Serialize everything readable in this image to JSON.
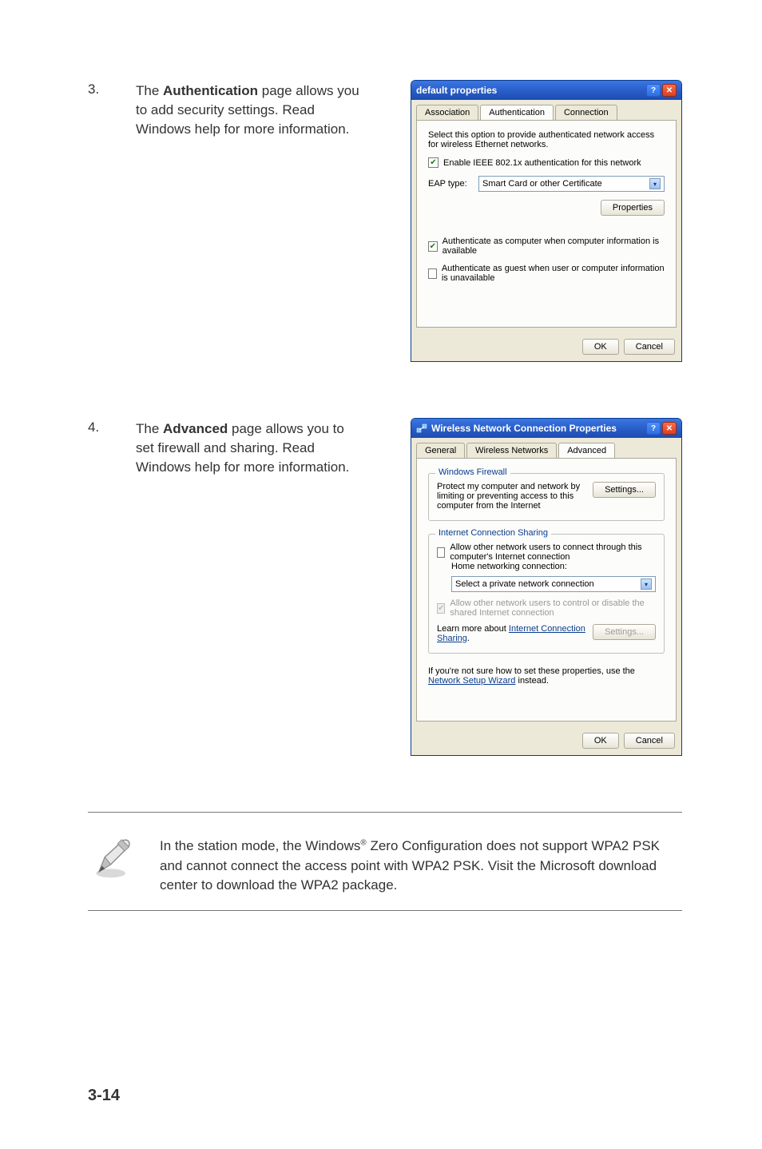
{
  "step3": {
    "num": "3.",
    "text_pre": "The ",
    "text_bold": "Authentication",
    "text_post": " page allows you to add security settings. Read Windows help for more information."
  },
  "dlg1": {
    "title": "default properties",
    "tabs": {
      "assoc": "Association",
      "auth": "Authentication",
      "conn": "Connection"
    },
    "desc": "Select this option to provide authenticated network access for wireless Ethernet networks.",
    "chk_enable": "Enable IEEE 802.1x authentication for this network",
    "eap_label": "EAP type:",
    "eap_value": "Smart Card or other Certificate",
    "btn_props": "Properties",
    "chk_auth_comp": "Authenticate as computer when computer information is available",
    "chk_auth_guest": "Authenticate as guest when user or computer information is unavailable",
    "btn_ok": "OK",
    "btn_cancel": "Cancel"
  },
  "step4": {
    "num": "4.",
    "text_pre": "The ",
    "text_bold": "Advanced",
    "text_post": " page allows you to set firewall and sharing. Read Windows help for more information."
  },
  "dlg2": {
    "title": "Wireless Network Connection Properties",
    "tabs": {
      "general": "General",
      "wnet": "Wireless Networks",
      "adv": "Advanced"
    },
    "grp_fw": "Windows Firewall",
    "fw_desc": "Protect my computer and network by limiting or preventing access to this computer from the Internet",
    "btn_settings": "Settings...",
    "grp_ics": "Internet Connection Sharing",
    "chk_allow": "Allow other network users to connect through this computer's Internet connection",
    "home_label": "Home networking connection:",
    "home_value": "Select a private network connection",
    "chk_allow_ctrl": "Allow other network users to control or disable the shared Internet connection",
    "learn_pre": "Learn more about ",
    "learn_link": "Internet Connection Sharing",
    "learn_post": ".",
    "btn_settings2": "Settings...",
    "help_pre": "If you're not sure how to set these properties, use the ",
    "help_link": "Network Setup Wizard",
    "help_post": " instead.",
    "btn_ok": "OK",
    "btn_cancel": "Cancel"
  },
  "note": {
    "text_pre": "In the station mode, the Windows",
    "reg": "®",
    "text_post": " Zero Configuration does not support WPA2 PSK and cannot connect the access point with WPA2 PSK. Visit the Microsoft download center to download the WPA2 package."
  },
  "page_num": "3-14"
}
